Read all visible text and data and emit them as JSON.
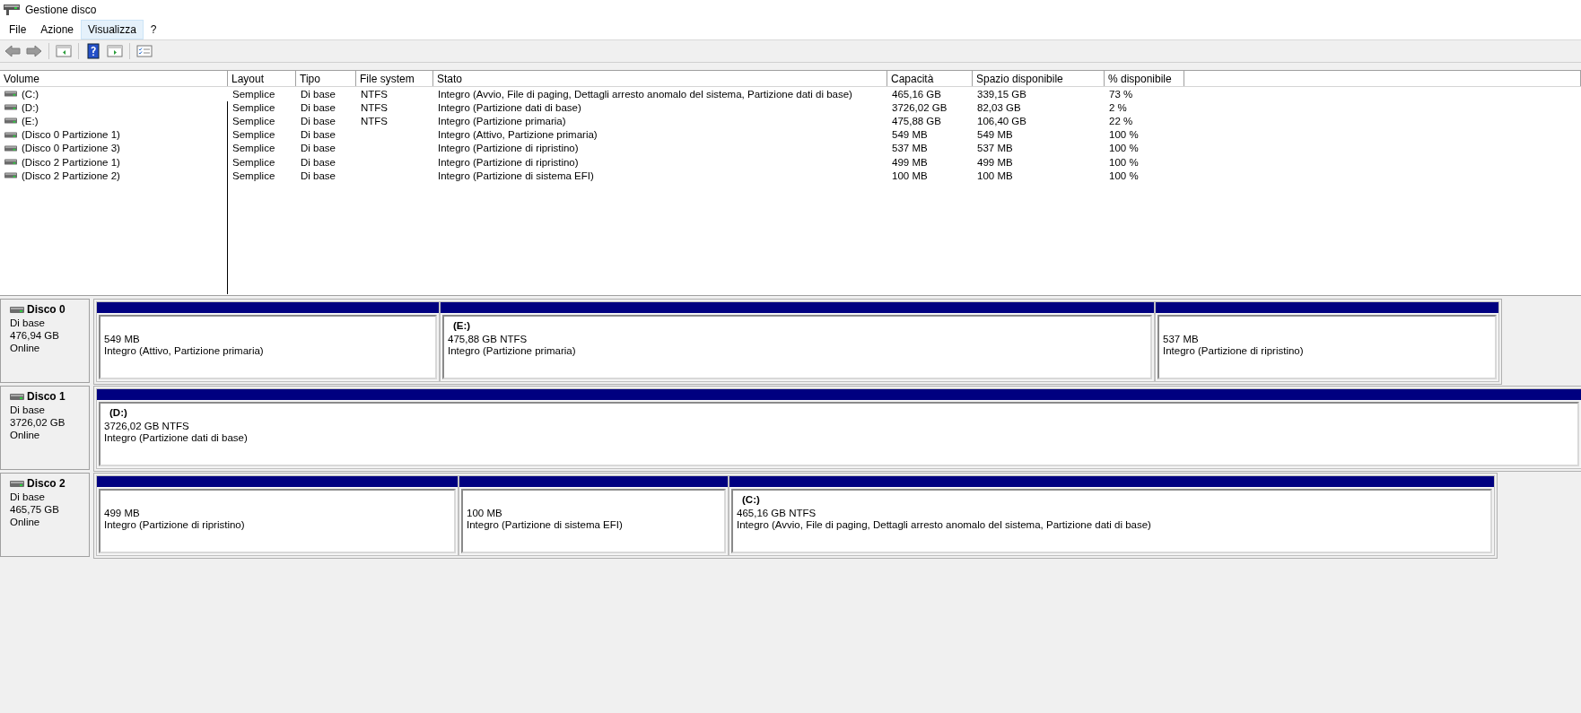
{
  "window": {
    "title": "Gestione disco"
  },
  "menu": [
    {
      "label": "File",
      "selected": false
    },
    {
      "label": "Azione",
      "selected": false
    },
    {
      "label": "Visualizza",
      "selected": true
    },
    {
      "label": "?",
      "selected": false
    }
  ],
  "table": {
    "columns": [
      "Volume",
      "Layout",
      "Tipo",
      "File system",
      "Stato",
      "Capacità",
      "Spazio disponibile",
      "% disponibile"
    ],
    "rows": [
      [
        "(C:)",
        "Semplice",
        "Di base",
        "NTFS",
        "Integro (Avvio, File di paging, Dettagli arresto anomalo del sistema, Partizione dati di base)",
        "465,16 GB",
        "339,15 GB",
        "73 %"
      ],
      [
        "(D:)",
        "Semplice",
        "Di base",
        "NTFS",
        "Integro (Partizione dati di base)",
        "3726,02 GB",
        "82,03 GB",
        "2 %"
      ],
      [
        "(E:)",
        "Semplice",
        "Di base",
        "NTFS",
        "Integro (Partizione primaria)",
        "475,88 GB",
        "106,40 GB",
        "22 %"
      ],
      [
        "(Disco 0 Partizione 1)",
        "Semplice",
        "Di base",
        "",
        "Integro (Attivo, Partizione primaria)",
        "549 MB",
        "549 MB",
        "100 %"
      ],
      [
        "(Disco 0 Partizione 3)",
        "Semplice",
        "Di base",
        "",
        "Integro (Partizione di ripristino)",
        "537 MB",
        "537 MB",
        "100 %"
      ],
      [
        "(Disco 2 Partizione 1)",
        "Semplice",
        "Di base",
        "",
        "Integro (Partizione di ripristino)",
        "499 MB",
        "499 MB",
        "100 %"
      ],
      [
        "(Disco 2 Partizione 2)",
        "Semplice",
        "Di base",
        "",
        "Integro (Partizione di sistema EFI)",
        "100 MB",
        "100 MB",
        "100 %"
      ]
    ]
  },
  "disks": [
    {
      "name": "Disco 0",
      "type": "Di base",
      "size": "476,94 GB",
      "state": "Online",
      "partitions": [
        {
          "size": "549 MB",
          "status": "Integro (Attivo, Partizione primaria)"
        },
        {
          "label": "(E:)",
          "size": "475,88 GB NTFS",
          "status": "Integro (Partizione primaria)"
        },
        {
          "size": "537 MB",
          "status": "Integro (Partizione di ripristino)"
        }
      ]
    },
    {
      "name": "Disco 1",
      "type": "Di base",
      "size": "3726,02 GB",
      "state": "Online",
      "partitions": [
        {
          "label": "(D:)",
          "size": "3726,02 GB NTFS",
          "status": "Integro (Partizione dati di base)"
        }
      ]
    },
    {
      "name": "Disco 2",
      "type": "Di base",
      "size": "465,75 GB",
      "state": "Online",
      "partitions": [
        {
          "size": "499 MB",
          "status": "Integro (Partizione di ripristino)"
        },
        {
          "size": "100 MB",
          "status": "Integro (Partizione di sistema EFI)"
        },
        {
          "label": "(C:)",
          "size": "465,16 GB NTFS",
          "status": "Integro (Avvio, File di paging, Dettagli arresto anomalo del sistema, Partizione dati di base)"
        }
      ]
    }
  ]
}
